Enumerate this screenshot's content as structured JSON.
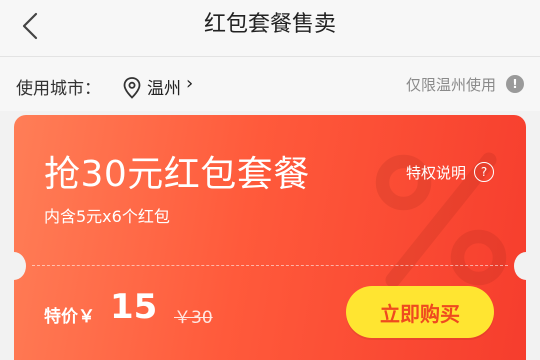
{
  "header": {
    "title": "红包套餐售卖"
  },
  "city_row": {
    "label": "使用城市：",
    "city": "温州",
    "chevron": "›",
    "restriction": "仅限温州使用",
    "info_icon": "!"
  },
  "card": {
    "headline": "抢30元红包套餐",
    "subline": "内含5元x6个红包",
    "privilege_label": "特权说明",
    "help_icon": "?",
    "price_label": "特价￥",
    "price": "15",
    "original_price": "￥30",
    "buy_button": "立即购买",
    "watermark_icon": "percent-icon"
  },
  "colors": {
    "card_gradient_start": "#ff7e57",
    "card_gradient_end": "#f63d2d",
    "buy_button_bg": "#ffe531",
    "buy_button_text": "#ef4a1f"
  }
}
